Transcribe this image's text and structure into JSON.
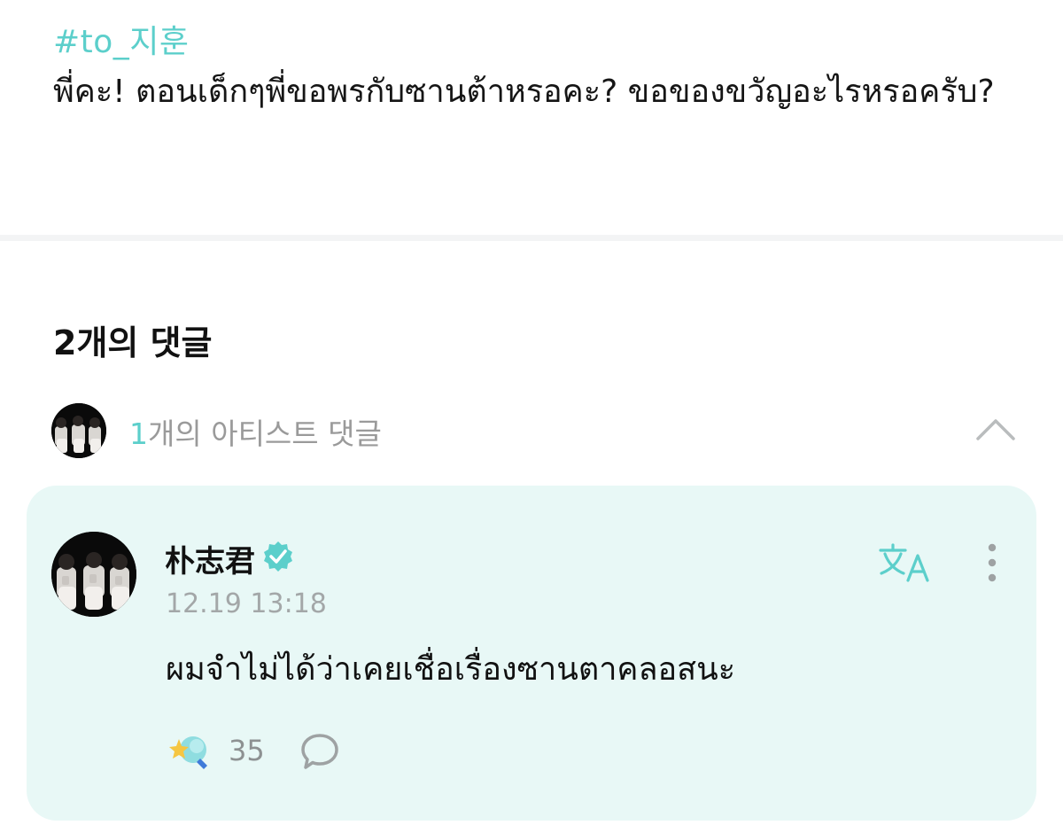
{
  "post": {
    "tag": "#to_지훈",
    "body": "พี่คะ! ตอนเด็กๆพี่ขอพรกับซานต้าหรอคะ? ขอของขวัญอะไรหรอครับ?"
  },
  "comments": {
    "count_label": "2개의 댓글",
    "artist_section": {
      "count": "1",
      "label": "개의 아티스트 댓글"
    }
  },
  "artist_comment": {
    "author": "朴志君",
    "verified": true,
    "time": "12.19 13:18",
    "text": "ผมจำไม่ได้ว่าเคยเชื่อเรื่องซานตาคลอสนะ",
    "reaction_count": "35"
  },
  "icons": {
    "collapse": "chevron-up-icon",
    "verified": "verified-badge-icon",
    "translate": "translate-icon",
    "more": "more-vertical-icon",
    "reaction": "star-reaction-icon",
    "reply": "reply-bubble-icon"
  },
  "colors": {
    "accent": "#5ccfcb",
    "card_background": "#e8f8f6",
    "muted_text": "#9a9a9a"
  }
}
